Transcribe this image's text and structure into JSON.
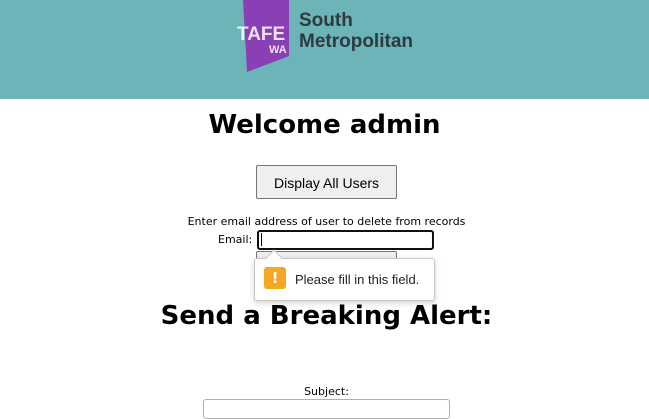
{
  "header": {
    "background_color": "#6db4b9",
    "logo": {
      "mark_text_1": "TAFE",
      "mark_text_2": "WA",
      "mark_color": "#8a3fb4",
      "name_line_1": "South",
      "name_line_2": "Metropolitan"
    }
  },
  "main": {
    "welcome_heading": "Welcome admin",
    "display_users_button": "Display All Users",
    "delete_instruction": "Enter email address of user to delete from records",
    "email_label": "Email:",
    "email_value": "",
    "validation_tooltip": {
      "icon": "warning-icon",
      "icon_color": "#f5a623",
      "message": "Please fill in this field."
    },
    "alert_heading": "Send a Breaking Alert:",
    "subject_label": "Subject:",
    "subject_value": ""
  }
}
